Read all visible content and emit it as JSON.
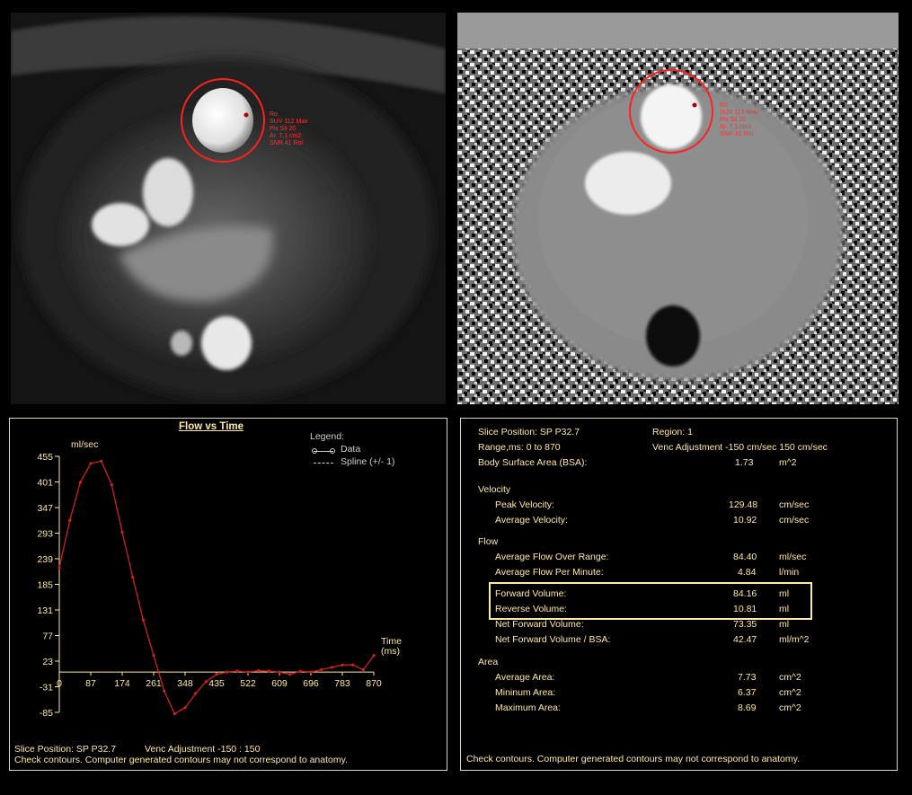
{
  "images": {
    "magnitude": {
      "annotation_lines": [
        "Ro",
        "SUV 112 Max",
        "Pix Sli 20",
        "Ar. 7.1 cm2",
        "SNR 41 Roi"
      ]
    },
    "phase": {
      "annotation_lines": [
        "Ro",
        "SUV 112 Max",
        "Pix Sli 20",
        "Ar. 7.1 cm2",
        "SNR 41 Roi"
      ]
    }
  },
  "chart": {
    "title": "Flow vs Time",
    "y_unit": "ml/sec",
    "x_label": "Time",
    "x_unit": "(ms)",
    "legend_title": "Legend:",
    "legend_data": "Data",
    "legend_spline": "Spline (+/- 1)",
    "footer_slice": "Slice Position: SP  P32.7",
    "footer_venc": "Venc Adjustment -150 : 150",
    "footer_note": "Check contours. Computer generated contours may not correspond to anatomy."
  },
  "chart_data": {
    "type": "line",
    "title": "Flow vs Time",
    "xlabel": "Time (ms)",
    "ylabel": "ml/sec",
    "xlim": [
      0,
      870
    ],
    "ylim": [
      -85,
      455
    ],
    "xticks": [
      0,
      87,
      174,
      261,
      348,
      435,
      522,
      609,
      696,
      783,
      870
    ],
    "yticks": [
      455,
      401,
      347,
      293,
      239,
      185,
      131,
      77,
      23,
      -31,
      -85
    ],
    "grid": false,
    "legend": "top-right",
    "series": [
      {
        "name": "Data",
        "x": [
          0,
          29,
          58,
          87,
          116,
          145,
          174,
          203,
          232,
          261,
          290,
          319,
          348,
          377,
          406,
          435,
          464,
          493,
          522,
          551,
          580,
          609,
          638,
          667,
          696,
          725,
          754,
          783,
          812,
          841,
          870
        ],
        "y": [
          220,
          320,
          400,
          440,
          445,
          395,
          295,
          200,
          110,
          35,
          -40,
          -88,
          -75,
          -45,
          -20,
          -5,
          0,
          2,
          0,
          3,
          2,
          0,
          -5,
          2,
          0,
          5,
          10,
          15,
          15,
          5,
          35
        ]
      }
    ]
  },
  "stats": {
    "slice_position": "Slice Position: SP  P32.7",
    "region": "Region:  1",
    "range": "Range,ms:   0  to  870",
    "venc": "Venc Adjustment    -150 cm/sec  150 cm/sec",
    "bsa_label": "Body Surface Area (BSA):",
    "bsa_value": "1.73",
    "bsa_unit": "m^2",
    "velocity_header": "Velocity",
    "velocity": [
      {
        "label": "Peak Velocity:",
        "value": "129.48",
        "unit": "cm/sec"
      },
      {
        "label": "Average Velocity:",
        "value": "10.92",
        "unit": "cm/sec"
      }
    ],
    "flow_header": "Flow",
    "flow": [
      {
        "label": "Average Flow Over Range:",
        "value": "84.40",
        "unit": "ml/sec"
      },
      {
        "label": "Average Flow Per Minute:",
        "value": "4.84",
        "unit": "l/min"
      },
      {
        "label": "Forward Volume:",
        "value": "84.16",
        "unit": "ml"
      },
      {
        "label": "Reverse Volume:",
        "value": "10.81",
        "unit": "ml"
      },
      {
        "label": "Net Forward Volume:",
        "value": "73.35",
        "unit": "ml"
      },
      {
        "label": "Net Forward Volume / BSA:",
        "value": "42.47",
        "unit": "ml/m^2"
      }
    ],
    "area_header": "Area",
    "area": [
      {
        "label": "Average Area:",
        "value": "7.73",
        "unit": "cm^2"
      },
      {
        "label": "Mininum Area:",
        "value": "6.37",
        "unit": "cm^2"
      },
      {
        "label": "Maximum Area:",
        "value": "8.69",
        "unit": "cm^2"
      }
    ],
    "footer_note": "Check contours. Computer generated contours may not correspond to anatomy.",
    "colors": {
      "text": "#ffe9a6",
      "series": "#cc2222",
      "contour": "#ff2020"
    }
  }
}
